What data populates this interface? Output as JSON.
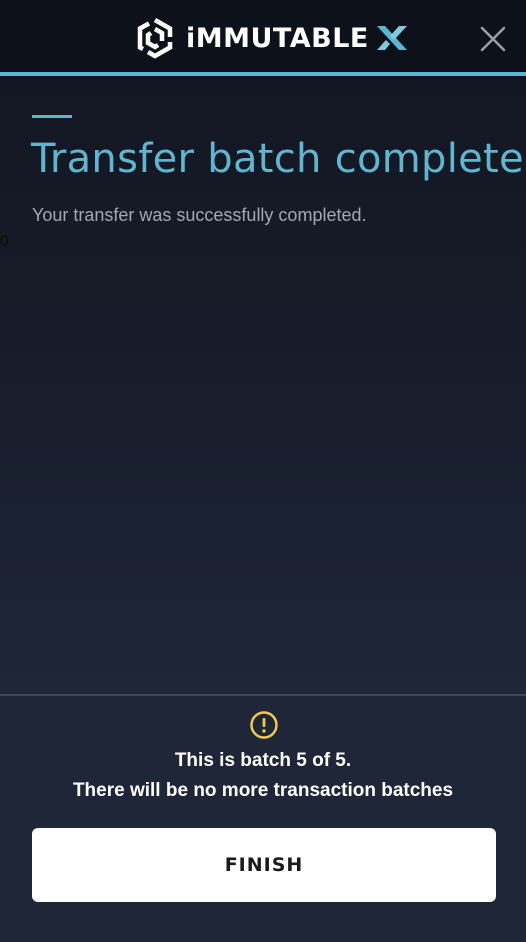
{
  "header": {
    "brand_name": "iMMUTABLE",
    "logo_icon": "immutable-hex-logo",
    "brand_mark": "x-mark",
    "close_icon": "close-icon",
    "accent_color": "#5ab7d0"
  },
  "main": {
    "title": "Transfer batch complete!",
    "subtitle": "Your transfer was successfully completed.",
    "stray_char": "0"
  },
  "footer": {
    "warning_icon": "exclamation-circle-icon",
    "batch_status": "This is batch 5 of 5.",
    "batch_note": "There will be no more transaction batches",
    "finish_label": "FINISH"
  }
}
